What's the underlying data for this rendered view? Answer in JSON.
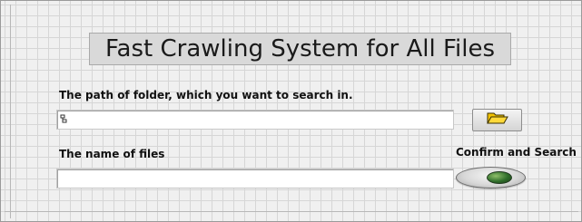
{
  "title": "Fast Crawling System for All Files",
  "path_section": {
    "label": "The path of folder, which you want to search in.",
    "value": "",
    "icon": "path-icon",
    "browse_icon": "folder-open-icon"
  },
  "name_section": {
    "label": "The name of files",
    "value": ""
  },
  "confirm_button": {
    "label": "Confirm and Search",
    "state": "off",
    "led_color": "#2f6d2a"
  },
  "colors": {
    "panel_bg": "#f0f0f0",
    "grid": "#d6d6d6",
    "title_bg": "#d9d9d9",
    "folder_icon": "#f2c200"
  }
}
